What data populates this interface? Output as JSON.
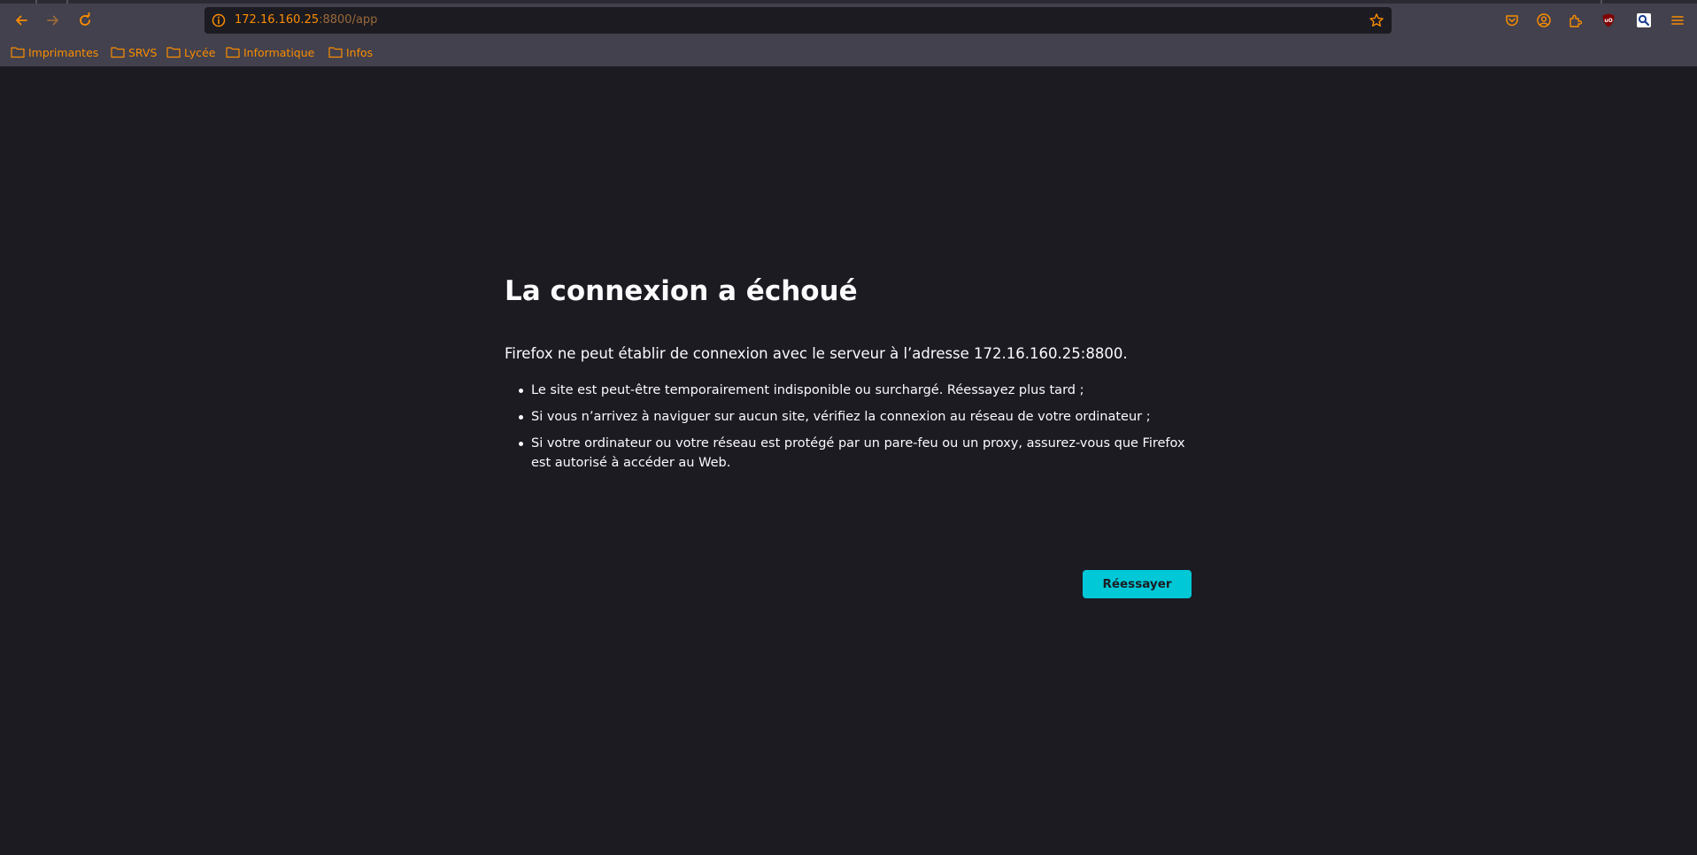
{
  "browser": {
    "url_host": "172.16.160.25",
    "url_path": ":8800/app",
    "accent_color": "#fb8c00",
    "icons": {
      "back": "back-arrow-icon",
      "forward": "forward-arrow-icon",
      "reload": "reload-icon",
      "site_info": "info-icon",
      "bookmark_star": "star-icon",
      "pocket": "pocket-icon",
      "account": "account-icon",
      "extensions": "extensions-icon",
      "ublock": "ublock-origin-icon",
      "search_extension": "magnifier-icon",
      "menu": "hamburger-menu-icon"
    },
    "ublock_label": "uO"
  },
  "bookmarks": [
    {
      "label": "Imprimantes"
    },
    {
      "label": "SRVS"
    },
    {
      "label": "Lycée"
    },
    {
      "label": "Informatique"
    },
    {
      "label": "Infos"
    }
  ],
  "error_page": {
    "title": "La connexion a échoué",
    "description": "Firefox ne peut établir de connexion avec le serveur à l’adresse 172.16.160.25:8800.",
    "reasons": [
      "Le site est peut-être temporairement indisponible ou surchargé. Réessayez plus tard ;",
      "Si vous n’arrivez à naviguer sur aucun site, vérifiez la connexion au réseau de votre ordinateur ;",
      "Si votre ordinateur ou votre réseau est protégé par un pare-feu ou un proxy, assurez-vous que Firefox est autorisé à accéder au Web."
    ],
    "retry_label": "Réessayer",
    "retry_color": "#00c8d7"
  }
}
